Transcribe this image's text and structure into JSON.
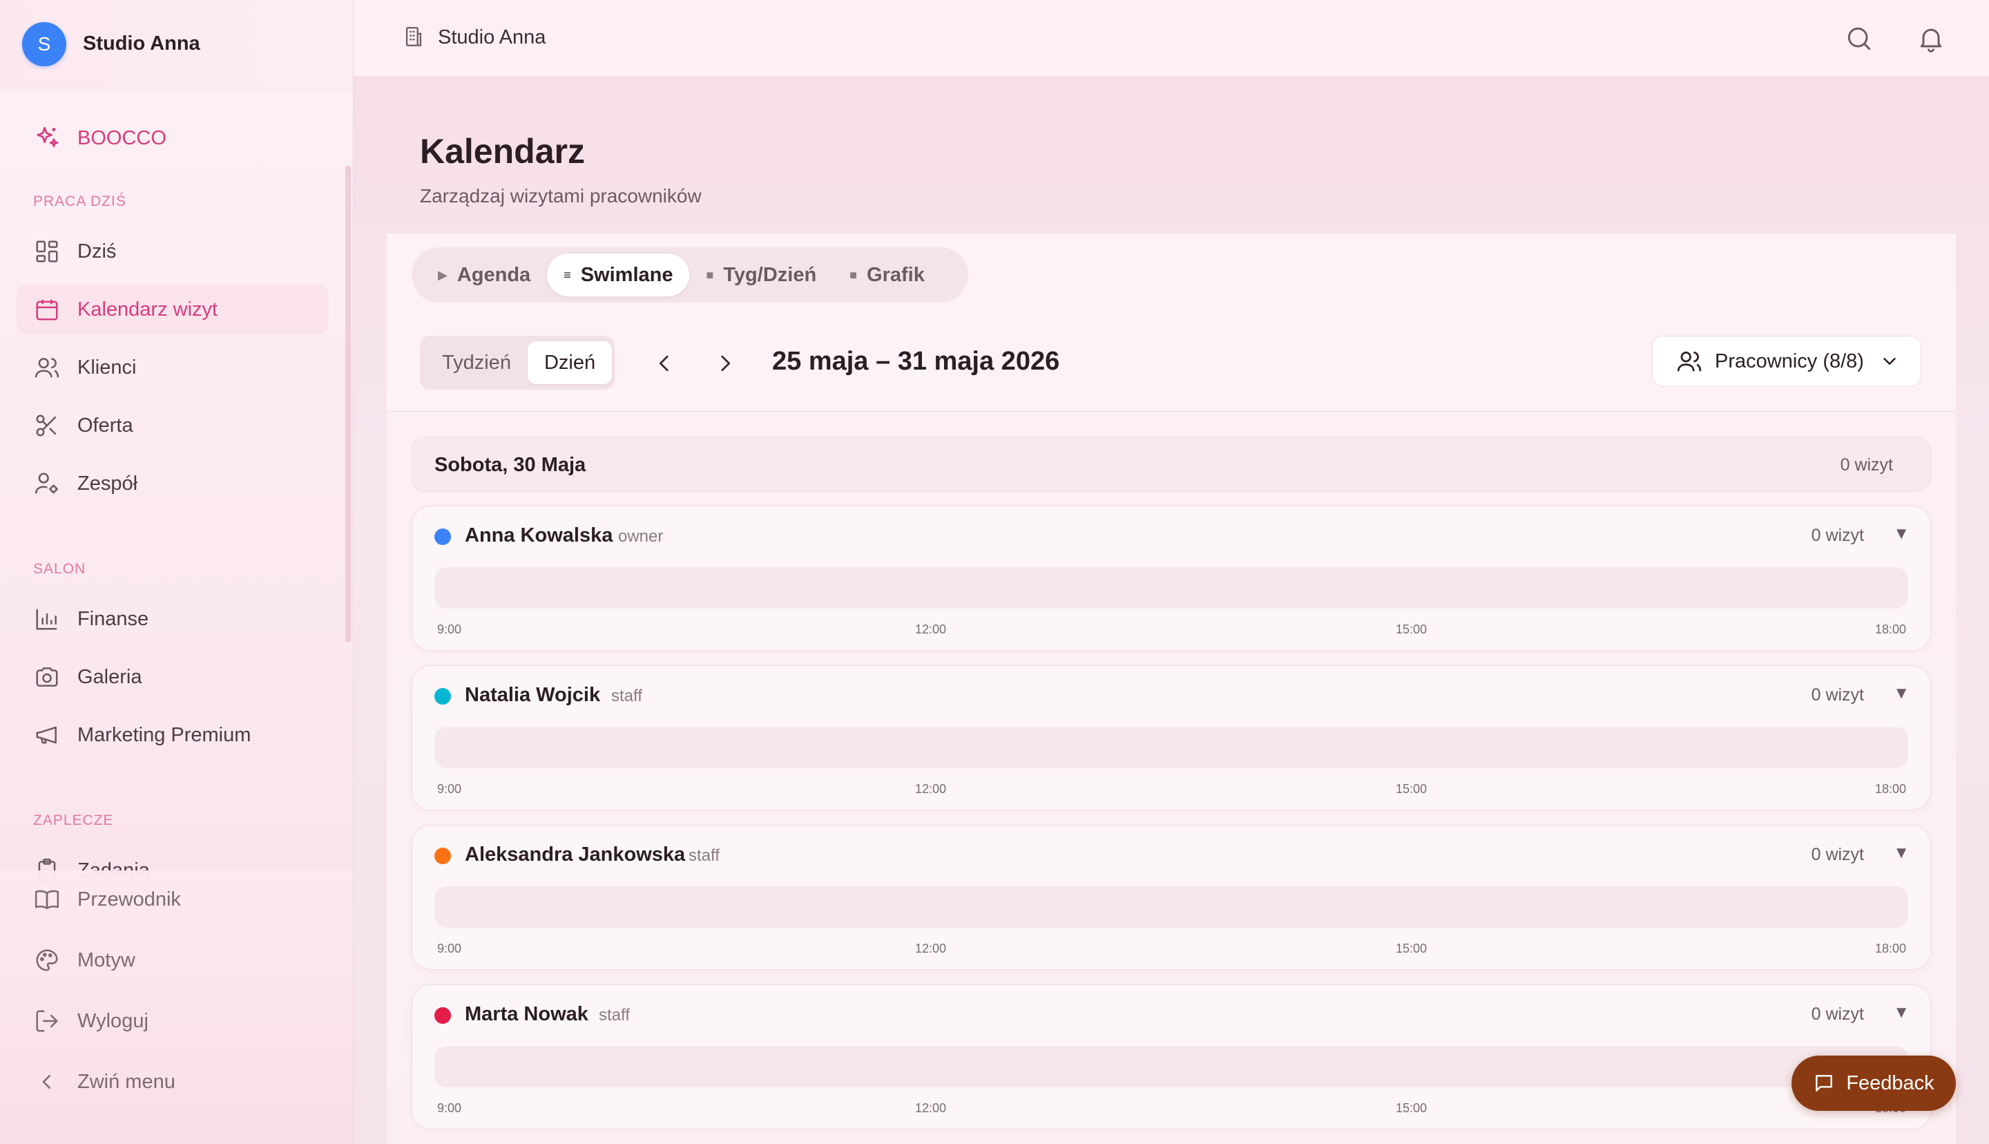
{
  "brand": {
    "initial": "S",
    "name": "Studio Anna",
    "color": "#3b82f6"
  },
  "sidebar": {
    "app_link": "BOOCCO",
    "sections": {
      "work_today": "PRACA DZIŚ",
      "salon": "SALON",
      "backroom": "ZAPLECZE"
    },
    "items": {
      "today": "Dziś",
      "calendar": "Kalendarz wizyt",
      "clients": "Klienci",
      "offer": "Oferta",
      "team": "Zespół",
      "finance": "Finanse",
      "gallery": "Galeria",
      "marketing": "Marketing Premium",
      "tasks": "Zadania"
    },
    "bottom": {
      "guide": "Przewodnik",
      "theme": "Motyw",
      "logout": "Wyloguj",
      "collapse": "Zwiń menu"
    }
  },
  "topbar": {
    "studio": "Studio Anna"
  },
  "page": {
    "title": "Kalendarz",
    "subtitle": "Zarządzaj wizytami pracowników"
  },
  "view_tabs": [
    {
      "label": "Agenda",
      "glyph": "▶"
    },
    {
      "label": "Swimlane",
      "glyph": "≡"
    },
    {
      "label": "Tyg/Dzień",
      "glyph": "■"
    },
    {
      "label": "Grafik",
      "glyph": "■"
    }
  ],
  "range_toggle": {
    "week": "Tydzień",
    "day": "Dzień"
  },
  "date_range": "25 maja – 31 maja 2026",
  "staff_filter": "Pracownicy (8/8)",
  "day": {
    "name": "Sobota, 30 Maja",
    "count": "0 wizyt"
  },
  "ticks": [
    "9:00",
    "12:00",
    "15:00",
    "18:00"
  ],
  "lanes": [
    {
      "name": "Anna Kowalska",
      "role": "owner",
      "count": "0 wizyt",
      "color": "#3b82f6"
    },
    {
      "name": "Natalia Wojcik",
      "role": "staff",
      "count": "0 wizyt",
      "color": "#06b6d4"
    },
    {
      "name": "Aleksandra Jankowska",
      "role": "staff",
      "count": "0 wizyt",
      "color": "#f97316"
    },
    {
      "name": "Marta Nowak",
      "role": "staff",
      "count": "0 wizyt",
      "color": "#e11d48"
    }
  ],
  "feedback": "Feedback",
  "colors": {
    "accent": "#d63c7e",
    "feedback": "#8a3a12"
  }
}
